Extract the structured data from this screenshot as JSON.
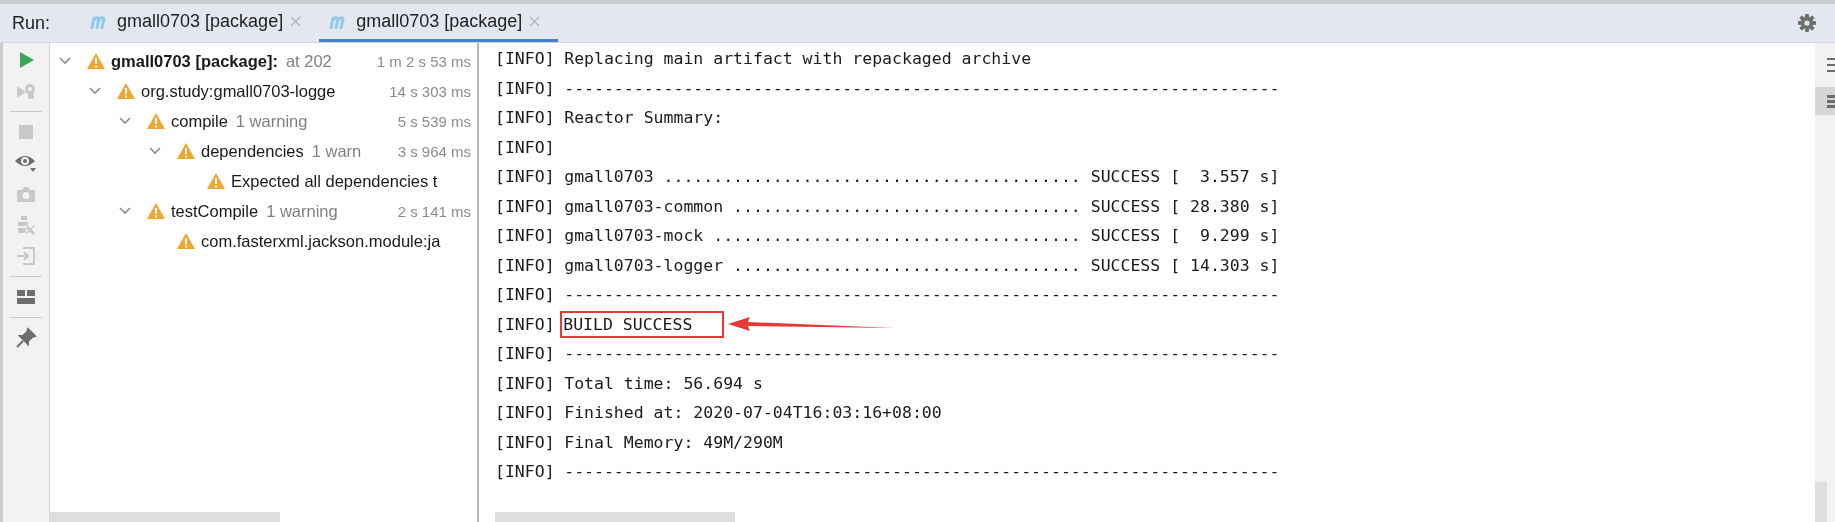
{
  "run_bar": {
    "label": "Run:"
  },
  "tabs": [
    {
      "label": "gmall0703 [package]",
      "selected": false
    },
    {
      "label": "gmall0703 [package]",
      "selected": true
    }
  ],
  "side_tools": [
    {
      "kind": "run",
      "disabled": false
    },
    {
      "kind": "rerun",
      "disabled": true
    },
    {
      "kind": "divider"
    },
    {
      "kind": "stop",
      "disabled": true
    },
    {
      "kind": "eye",
      "disabled": false
    },
    {
      "kind": "camera",
      "disabled": true
    },
    {
      "kind": "tests",
      "disabled": true
    },
    {
      "kind": "import",
      "disabled": true
    },
    {
      "kind": "divider"
    },
    {
      "kind": "layout",
      "disabled": false
    },
    {
      "kind": "divider"
    },
    {
      "kind": "pin",
      "disabled": false
    }
  ],
  "tree": [
    {
      "title": "gmall0703 [package]:",
      "note": "at 202",
      "time": "1 m 2 s 53 ms",
      "expanded": true,
      "children": [
        {
          "title": "org.study:gmall0703-logge",
          "time": "14 s 303 ms",
          "expanded": true,
          "children": [
            {
              "title": "compile",
              "note": "1 warning",
              "time": "5 s 539 ms",
              "expanded": true,
              "children": [
                {
                  "title": "dependencies",
                  "note": "1 warn",
                  "time": "3 s 964 ms",
                  "expanded": true,
                  "children": [
                    {
                      "title": "Expected all dependencies t"
                    }
                  ]
                }
              ]
            },
            {
              "title": "testCompile",
              "note": "1 warning",
              "time": "2 s 141 ms",
              "expanded": true,
              "children": [
                {
                  "title": "com.fasterxml.jackson.module:ja"
                }
              ]
            }
          ]
        }
      ]
    }
  ],
  "console": {
    "lines": [
      {
        "prefix": "[INFO]",
        "text": "Replacing main artifact with repackaged archive",
        "boxed": false
      },
      {
        "prefix": "[INFO]",
        "text": "------------------------------------------------------------------------",
        "boxed": false
      },
      {
        "prefix": "[INFO]",
        "text": "Reactor Summary:",
        "boxed": false
      },
      {
        "prefix": "[INFO]",
        "boxed": false
      },
      {
        "prefix": "[INFO]",
        "text": "gmall0703 .......................................... SUCCESS [  3.557 s]",
        "boxed": false
      },
      {
        "prefix": "[INFO]",
        "text": "gmall0703-common ................................... SUCCESS [ 28.380 s]",
        "boxed": false
      },
      {
        "prefix": "[INFO]",
        "text": "gmall0703-mock ..................................... SUCCESS [  9.299 s]",
        "boxed": false
      },
      {
        "prefix": "[INFO]",
        "text": "gmall0703-logger ................................... SUCCESS [ 14.303 s]",
        "boxed": false
      },
      {
        "prefix": "[INFO]",
        "text": "------------------------------------------------------------------------",
        "boxed": false
      },
      {
        "prefix": "[INFO]",
        "text": "BUILD SUCCESS",
        "boxed": true
      },
      {
        "prefix": "[INFO]",
        "text": "------------------------------------------------------------------------",
        "boxed": false
      },
      {
        "prefix": "[INFO]",
        "text": "Total time: 56.694 s",
        "boxed": false
      },
      {
        "prefix": "[INFO]",
        "text": "Finished at: 2020-07-04T16:03:16+08:00",
        "boxed": false
      },
      {
        "prefix": "[INFO]",
        "text": "Final Memory: 49M/290M",
        "boxed": false
      },
      {
        "prefix": "[INFO]",
        "text": "------------------------------------------------------------------------",
        "boxed": false
      }
    ]
  }
}
